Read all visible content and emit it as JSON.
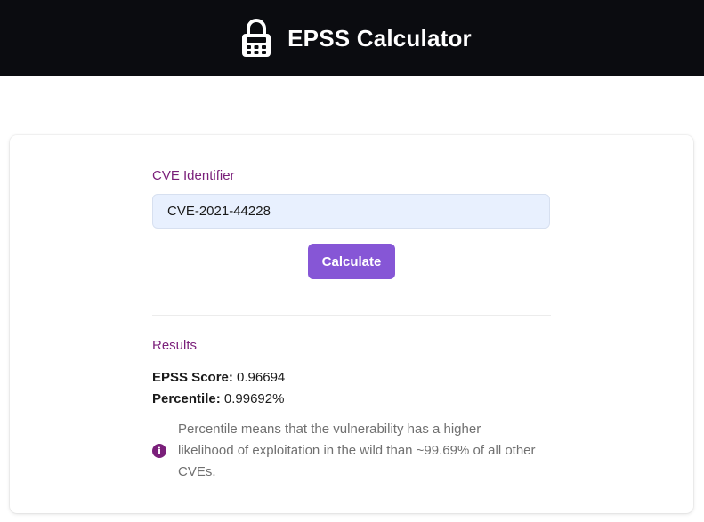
{
  "header": {
    "title": "EPSS Calculator",
    "logo_icon": "lock-calculator-icon"
  },
  "form": {
    "label": "CVE Identifier",
    "input_value": "CVE-2021-44228",
    "button_label": "Calculate"
  },
  "results": {
    "heading": "Results",
    "epss_label": "EPSS Score:",
    "epss_value": "0.96694",
    "percentile_label": "Percentile:",
    "percentile_value": "0.99692%",
    "info_icon": "info-icon",
    "info_text": "Percentile means that the vulnerability has a higher likelihood of exploitation in the wild than ~99.69% of all other CVEs."
  },
  "colors": {
    "header_bg": "#0b0c10",
    "accent": "#8656d6",
    "label": "#7a1f7a"
  }
}
